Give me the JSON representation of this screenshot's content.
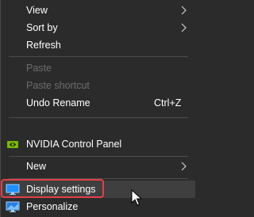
{
  "menu": {
    "view": {
      "label": "View",
      "icon": "chevron-right-icon"
    },
    "sort_by": {
      "label": "Sort by",
      "icon": "chevron-right-icon"
    },
    "refresh": {
      "label": "Refresh"
    },
    "paste": {
      "label": "Paste",
      "enabled": false
    },
    "paste_shortcut": {
      "label": "Paste shortcut",
      "enabled": false
    },
    "undo": {
      "label": "Undo Rename",
      "shortcut": "Ctrl+Z"
    },
    "nvidia": {
      "label": "NVIDIA Control Panel",
      "icon": "nvidia-icon"
    },
    "new": {
      "label": "New",
      "icon": "chevron-right-icon"
    },
    "display_settings": {
      "label": "Display settings",
      "icon": "display-icon",
      "highlighted": true
    },
    "personalize": {
      "label": "Personalize",
      "icon": "personalize-icon"
    }
  },
  "colors": {
    "background": "#2b2b2b",
    "text": "#ffffff",
    "disabled_text": "#6d6d6d",
    "separator": "#4c4c4c",
    "highlight_outline": "#e0404a",
    "hover": "#3f3f3f"
  }
}
